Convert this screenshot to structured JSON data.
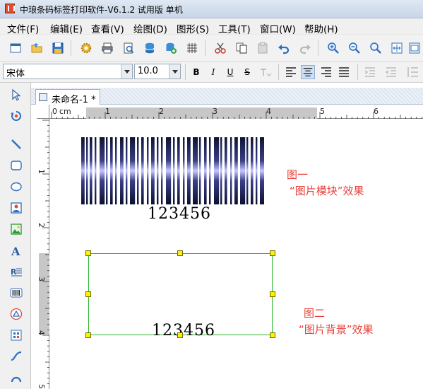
{
  "window": {
    "title": "中琅条码标签打印软件-V6.1.2 试用版 单机"
  },
  "menu": [
    "文件(F)",
    "编辑(E)",
    "查看(V)",
    "绘图(D)",
    "图形(S)",
    "工具(T)",
    "窗口(W)",
    "帮助(H)"
  ],
  "toolbar": {
    "icons": [
      "new-window-icon",
      "open-folder-icon",
      "save-icon",
      "settings-gear-icon",
      "print-icon",
      "print-preview-icon",
      "database-icon",
      "database-link-icon",
      "grid-icon",
      "cut-icon",
      "copy-icon",
      "paste-icon",
      "undo-icon",
      "redo-icon",
      "zoom-in-icon",
      "zoom-out-icon",
      "zoom-fit-icon",
      "fit-page-icon",
      "fit-width-icon"
    ]
  },
  "fontbar": {
    "font_family": "宋体",
    "font_size": "10.0",
    "buttons": [
      "B",
      "I",
      "U",
      "S"
    ]
  },
  "left_tools": [
    "select-pointer-icon",
    "rotate-icon",
    "line-icon",
    "rounded-rect-icon",
    "ellipse-icon",
    "image-icon",
    "picture-icon",
    "text-icon",
    "rich-text-icon",
    "barcode-icon",
    "qrcode-icon",
    "shape-icon",
    "polyline-icon",
    "arc-icon"
  ],
  "document": {
    "tab_label": "未命名-1 *"
  },
  "ruler": {
    "unit": "cm",
    "h_labels": [
      "0",
      "cm",
      "1",
      "2",
      "3",
      "4",
      "5",
      "6"
    ],
    "v_labels": [
      "1",
      "2",
      "3",
      "4",
      "5"
    ]
  },
  "canvas": {
    "barcode1": {
      "text": "123456"
    },
    "barcode2": {
      "text": "123456"
    },
    "annotation1": {
      "line1": "图一",
      "line2": "“图片模块”效果"
    },
    "annotation2": {
      "line1": "图二",
      "line2": "“图片背景”效果"
    }
  },
  "colors": {
    "annotation": "#e8413a",
    "selection": "#2cb52c",
    "handle": "#ffef00",
    "galaxy_dark": "#0e1433",
    "galaxy_light": "#c6c8ff"
  }
}
